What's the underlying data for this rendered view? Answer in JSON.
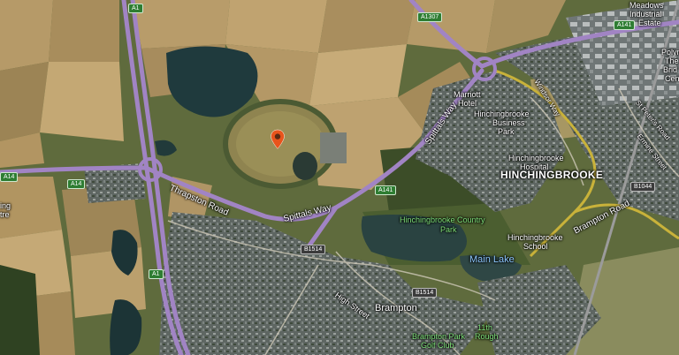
{
  "map": {
    "marker": {
      "icon": "location-pin-icon",
      "color": "#e8541c"
    },
    "roads": {
      "a14_name": "A14",
      "thrapston": "Thrapston Road",
      "spittals_a": "Spittals Way",
      "spittals_b": "Spittals Way",
      "brampton_rd": "Brampton Road",
      "high_street": "High Street",
      "st_peters": "St Peter's Road",
      "ermine": "Ermine Street",
      "windsor": "Windsor Way"
    },
    "shields": {
      "a14_left": "A14",
      "a14_mid": "A14",
      "a1_upper": "A1",
      "a1_lower": "A1",
      "a1307": "A1307",
      "a141_top": "A141",
      "a141_mid": "A141",
      "b1514_a": "B1514",
      "b1514_b": "B1514",
      "b1044": "B1044"
    },
    "places": {
      "meadows": "Meadows",
      "industrial": "Industrial",
      "estate": "Estate",
      "marriott": "Marriott",
      "hotel": "Hotel",
      "hbp1": "Hinchingbrooke",
      "hbp2": "Business",
      "hbp3": "Park",
      "hosp1": "Hinchingbrooke",
      "hosp2": "Hospital",
      "hinchingbrooke": "HINCHINGBROOKE",
      "country_park1": "Hinchingbrooke Country",
      "country_park2": "Park",
      "school1": "Hinchingbrooke",
      "school2": "School",
      "main_lake": "Main Lake",
      "brampton": "Brampton",
      "golf1": "Brampton Park",
      "golf2": "Golf Club",
      "eleventh1": "11th",
      "eleventh2": "Rough",
      "ing": "ing",
      "tre": "tre",
      "polyme": "Polyme",
      "the": "The",
      "brid": "Brid",
      "cen": "Cen"
    }
  }
}
